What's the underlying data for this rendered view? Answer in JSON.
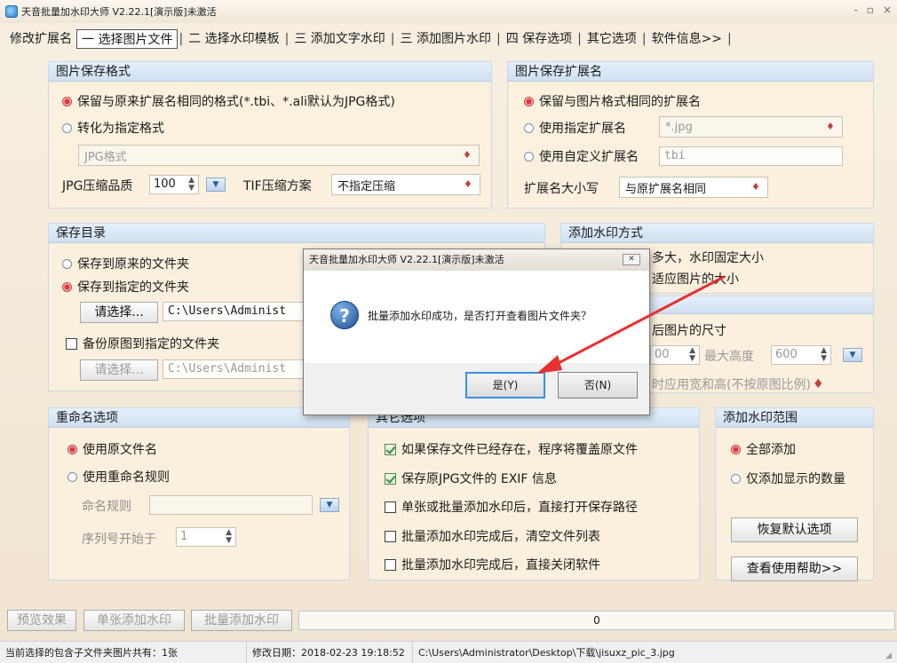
{
  "window": {
    "title": "天音批量加水印大师 V2.22.1[演示版]未激活",
    "controls": [
      "-",
      "▫",
      "×"
    ]
  },
  "menu": {
    "items": [
      "修改扩展名",
      "一 选择图片文件",
      "二 选择水印模板",
      "三 添加文字水印",
      "三 添加图片水印",
      "四 保存选项",
      "其它选项",
      "软件信息>>"
    ],
    "separator": "|"
  },
  "save_format": {
    "title": "图片保存格式",
    "opt_keep": "保留与原来扩展名相同的格式(*.tbi、*.ali默认为JPG格式)",
    "opt_convert": "转化为指定格式",
    "format_value": "JPG格式",
    "jpg_quality_label": "JPG压缩品质",
    "jpg_quality_value": "100",
    "tif_label": "TIF压缩方案",
    "tif_value": "不指定压缩"
  },
  "save_ext": {
    "title": "图片保存扩展名",
    "opt_same": "保留与图片格式相同的扩展名",
    "opt_specified": "使用指定扩展名",
    "specified_value": "*.jpg",
    "opt_custom": "使用自定义扩展名",
    "custom_value": "tbi",
    "case_label": "扩展名大小写",
    "case_value": "与原扩展名相同"
  },
  "save_dir": {
    "title": "保存目录",
    "opt_original": "保存到原来的文件夹",
    "opt_specified": "保存到指定的文件夹",
    "choose_label": "请选择...",
    "path_value": "C:\\Users\\Administ",
    "backup_label": "备份原图到指定的文件夹",
    "backup_choose_label": "请选择...",
    "backup_path_value": "C:\\Users\\Administ"
  },
  "watermark_mode": {
    "title": "添加水印方式",
    "line1": "多大，水印固定大小",
    "line2": "适应图片的大小",
    "size_line": "后图片的尺寸",
    "max_height_label": "最大高度",
    "width_value": "00",
    "height_value": "600",
    "ratio_line": "时应用宽和高(不按原图比例)"
  },
  "rename": {
    "title": "重命名选项",
    "opt_original": "使用原文件名",
    "opt_rule": "使用重命名规则",
    "rule_label": "命名规则",
    "seq_label": "序列号开始于",
    "seq_value": "1"
  },
  "other": {
    "title": "其它选项",
    "opt1": "如果保存文件已经存在，程序将覆盖原文件",
    "opt2": "保存原JPG文件的 EXIF 信息",
    "opt3": "单张或批量添加水印后，直接打开保存路径",
    "opt4": "批量添加水印完成后，清空文件列表",
    "opt5": "批量添加水印完成后，直接关闭软件"
  },
  "range": {
    "title": "添加水印范围",
    "opt_all": "全部添加",
    "opt_shown": "仅添加显示的数量",
    "restore_button": "恢复默认选项",
    "help_button": "查看使用帮助>>"
  },
  "actions": {
    "preview": "预览效果",
    "single": "单张添加水印",
    "batch": "批量添加水印",
    "progress_text": "0",
    "progress_value": 0
  },
  "status": {
    "count": "当前选择的包含子文件夹图片共有：1张",
    "modified": "修改日期：2018-02-23 19:18:52",
    "path": "C:\\Users\\Administrator\\Desktop\\下载\\jisuxz_pic_3.jpg"
  },
  "dialog": {
    "title": "天音批量加水印大师 V2.22.1[演示版]未激活",
    "close": "✕",
    "message": "批量添加水印成功，是否打开查看图片文件夹？",
    "yes": "是(Y)",
    "no": "否(N)"
  },
  "colors": {
    "annotation_arrow": "#e8302e",
    "group_header": "#d4e3f4",
    "panel_background": "#f7efe2"
  }
}
